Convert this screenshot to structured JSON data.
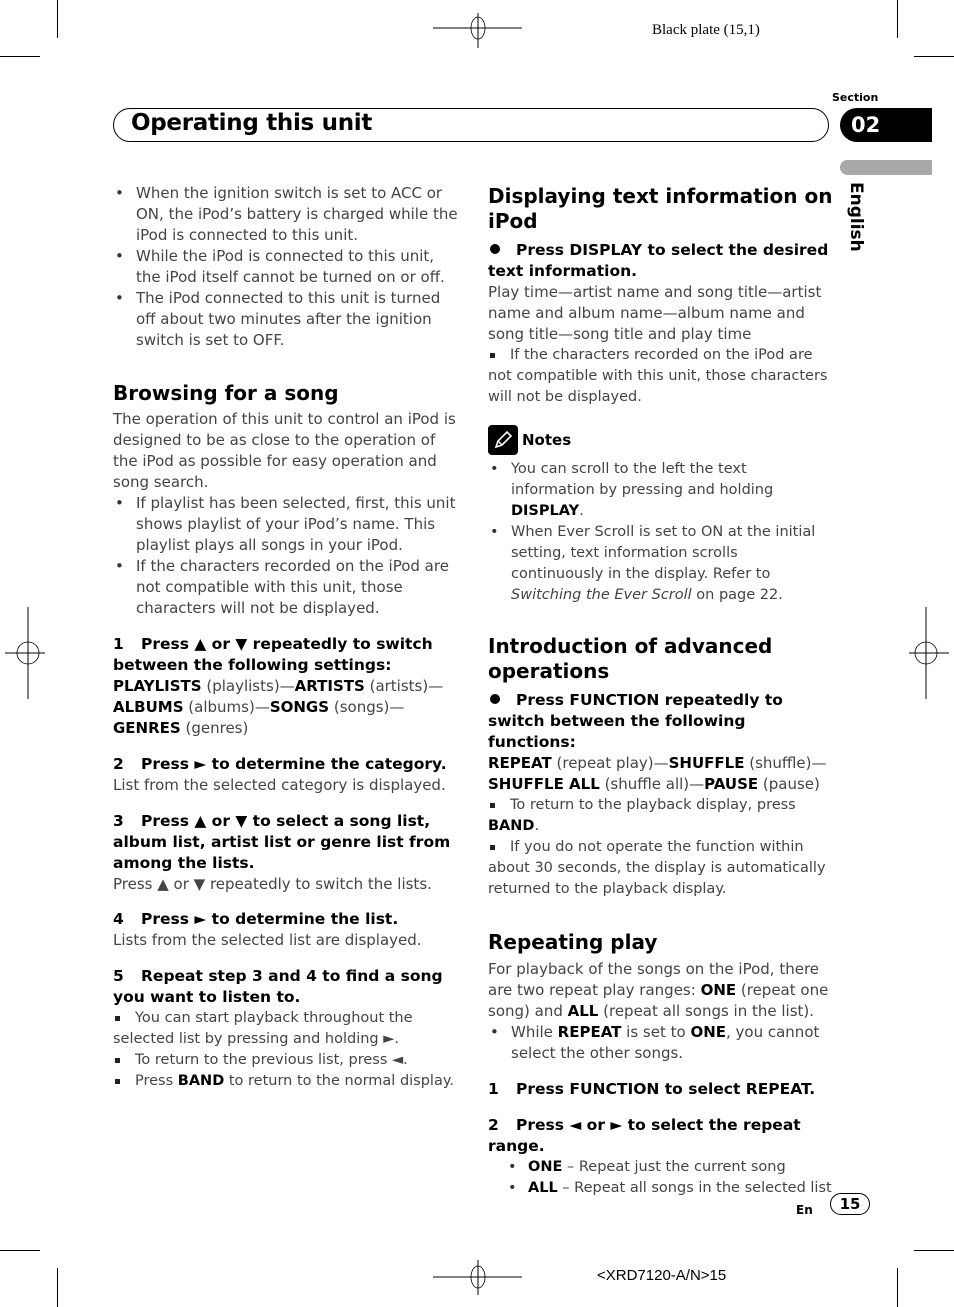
{
  "print_marks": {
    "plate": "Black plate (15,1)",
    "footer_code": "<XRD7120-A/N>15"
  },
  "header": {
    "title": "Operating this unit",
    "section_label": "Section",
    "section_number": "02",
    "language": "English"
  },
  "left_column": {
    "intro_bullets": [
      "When the ignition switch is set to ACC or ON, the iPod’s battery is charged while the iPod is connected to this unit.",
      "While the iPod is connected to this unit, the iPod itself cannot be turned on or off.",
      "The iPod connected to this unit is turned off about two minutes after the ignition switch is set to OFF."
    ],
    "browsing": {
      "heading": "Browsing for a song",
      "body": "The operation of this unit to control an iPod is designed to be as close to the operation of the iPod as possible for easy operation and song search.",
      "bullets": [
        "If playlist has been selected, first, this unit shows playlist of your iPod’s name. This playlist plays all songs in your iPod.",
        "If the characters recorded on the iPod are not compatible with this unit, those characters will not be displayed."
      ],
      "steps": [
        {
          "num": "1",
          "title": "Press ▲ or ▼ repeatedly to switch between the following settings:",
          "settings": [
            {
              "name": "PLAYLISTS",
              "desc": "(playlists)"
            },
            {
              "name": "ARTISTS",
              "desc": "(artists)"
            },
            {
              "name": "ALBUMS",
              "desc": "(albums)"
            },
            {
              "name": "SONGS",
              "desc": "(songs)"
            },
            {
              "name": "GENRES",
              "desc": "(genres)"
            }
          ]
        },
        {
          "num": "2",
          "title": "Press ► to determine the category.",
          "body": "List from the selected category is displayed."
        },
        {
          "num": "3",
          "title": "Press ▲ or ▼ to select a song list, album list, artist list or genre list from among the lists.",
          "body": "Press ▲ or ▼ repeatedly to switch the lists."
        },
        {
          "num": "4",
          "title": "Press ► to determine the list.",
          "body": "Lists from the selected list are displayed."
        },
        {
          "num": "5",
          "title": "Repeat step 3 and 4 to find a song you want to listen to.",
          "notes": [
            "You can start playback throughout the selected list by pressing and holding ►.",
            "To return to the previous list, press ◄."
          ],
          "band_note": {
            "pre": "Press ",
            "bold": "BAND",
            "post": " to return to the normal display."
          }
        }
      ]
    }
  },
  "right_column": {
    "displaying": {
      "heading": "Displaying text information on iPod",
      "step": "Press DISPLAY to select the desired text information.",
      "body": "Play time—artist name and song title—artist name and album name—album name and song title—song title and play time",
      "note": "If the characters recorded on the iPod are not compatible with this unit, those characters will not be displayed."
    },
    "notes": {
      "label": "Notes",
      "item1": {
        "pre": "You can scroll to the left the text information by pressing and holding ",
        "bold": "DISPLAY",
        "post": "."
      },
      "item2": {
        "pre": "When Ever Scroll is set to ON at the initial setting, text information scrolls continuously in the display. Refer to ",
        "italic": "Switching the Ever Scroll",
        "post": " on page 22."
      }
    },
    "advanced": {
      "heading": "Introduction of advanced operations",
      "step": "Press FUNCTION repeatedly to switch between the following functions:",
      "functions": [
        {
          "name": "REPEAT",
          "desc": "(repeat play)"
        },
        {
          "name": "SHUFFLE",
          "desc": "(shuffle)"
        },
        {
          "name": "SHUFFLE ALL",
          "desc": "(shuffle all)"
        },
        {
          "name": "PAUSE",
          "desc": "(pause)"
        }
      ],
      "note1": {
        "pre": "To return to the playback display, press ",
        "bold": "BAND",
        "post": "."
      },
      "note2": "If you do not operate the function within about 30 seconds, the display is automatically returned to the playback display."
    },
    "repeating": {
      "heading": "Repeating play",
      "body": {
        "p1": "For playback of the songs on the iPod, there are two repeat play ranges: ",
        "b1": "ONE",
        "p2": " (repeat one song) and ",
        "b2": "ALL",
        "p3": " (repeat all songs in the list)."
      },
      "bullet": {
        "p1": "While ",
        "b1": "REPEAT",
        "p2": " is set to ",
        "b2": "ONE",
        "p3": ", you cannot select the other songs."
      },
      "steps": [
        {
          "num": "1",
          "title": "Press FUNCTION to select REPEAT."
        },
        {
          "num": "2",
          "title": "Press ◄ or ► to select the repeat range."
        }
      ],
      "options": [
        {
          "name": "ONE",
          "desc": " – Repeat just the current song"
        },
        {
          "name": "ALL",
          "desc": " – Repeat all songs in the selected list"
        }
      ]
    }
  },
  "footer": {
    "lang_code": "En",
    "page_number": "15"
  }
}
